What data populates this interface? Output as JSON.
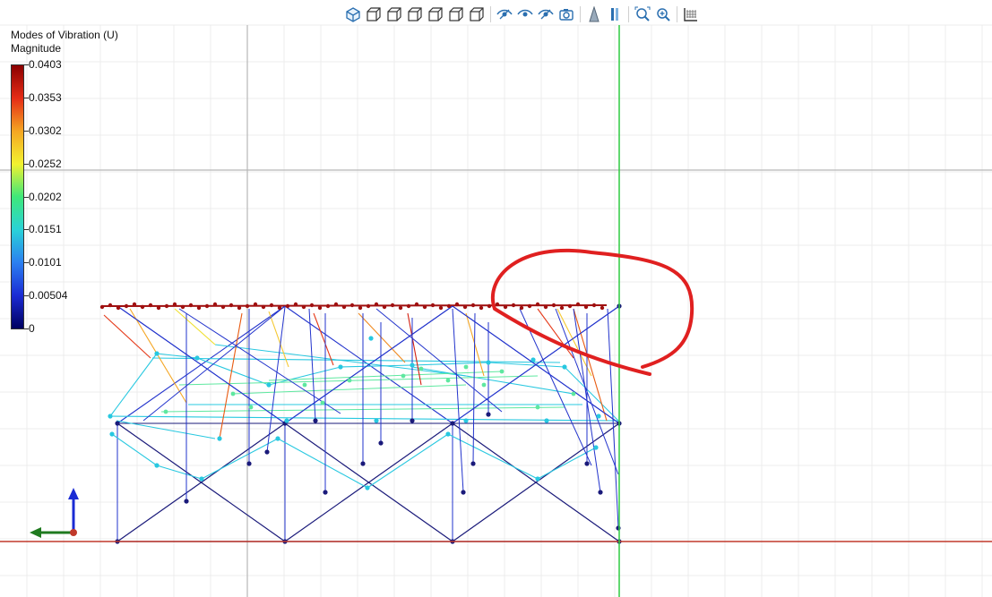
{
  "toolbar": {
    "groups": [
      [
        "iso-view",
        "front-view",
        "back-view",
        "left-view",
        "right-view",
        "top-view",
        "bottom-view"
      ],
      [
        "eye-show",
        "eye-hide",
        "eye-toggle",
        "camera-snapshot"
      ],
      [
        "transparency",
        "section-plane"
      ],
      [
        "zoom-fit",
        "zoom-in"
      ],
      [
        "grid-toggle"
      ]
    ]
  },
  "legend": {
    "title": "Modes of Vibration (U)",
    "subtitle": "Magnitude",
    "labels": [
      "0.0403",
      "0.0353",
      "0.0302",
      "0.0252",
      "0.0202",
      "0.0151",
      "0.0101",
      "0.00504",
      "0"
    ],
    "colors": [
      "#8b0000",
      "#e52c16",
      "#f5a623",
      "#f2f230",
      "#3ee87a",
      "#2ad2d8",
      "#2b7ff0",
      "#1a2bd4",
      "#000060"
    ]
  },
  "scene": {
    "axis_x_color": "#c0392b",
    "axis_y_color": "#2ecc40",
    "annotation_color": "#e02020"
  }
}
